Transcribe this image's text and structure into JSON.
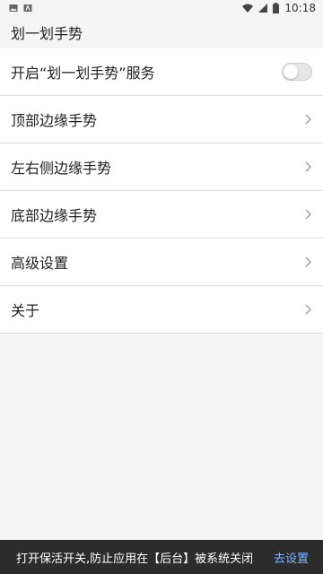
{
  "status_bar": {
    "time": "10:18",
    "icons": [
      "image-notification-icon",
      "a-notification-icon",
      "wifi-icon",
      "cellular-signal-icon",
      "battery-icon"
    ]
  },
  "app_bar": {
    "title": "划一划手势"
  },
  "settings": {
    "items": [
      {
        "label": "开启“划一划手势”服务",
        "type": "toggle",
        "enabled": false
      },
      {
        "label": "顶部边缘手势",
        "type": "nav"
      },
      {
        "label": "左右侧边缘手势",
        "type": "nav"
      },
      {
        "label": "底部边缘手势",
        "type": "nav"
      },
      {
        "label": "高级设置",
        "type": "nav"
      },
      {
        "label": "关于",
        "type": "nav"
      }
    ]
  },
  "snackbar": {
    "message": "打开保活开关,防止应用在【后台】被系统关闭",
    "action": "去设置",
    "action_color": "#7fb3ff"
  }
}
